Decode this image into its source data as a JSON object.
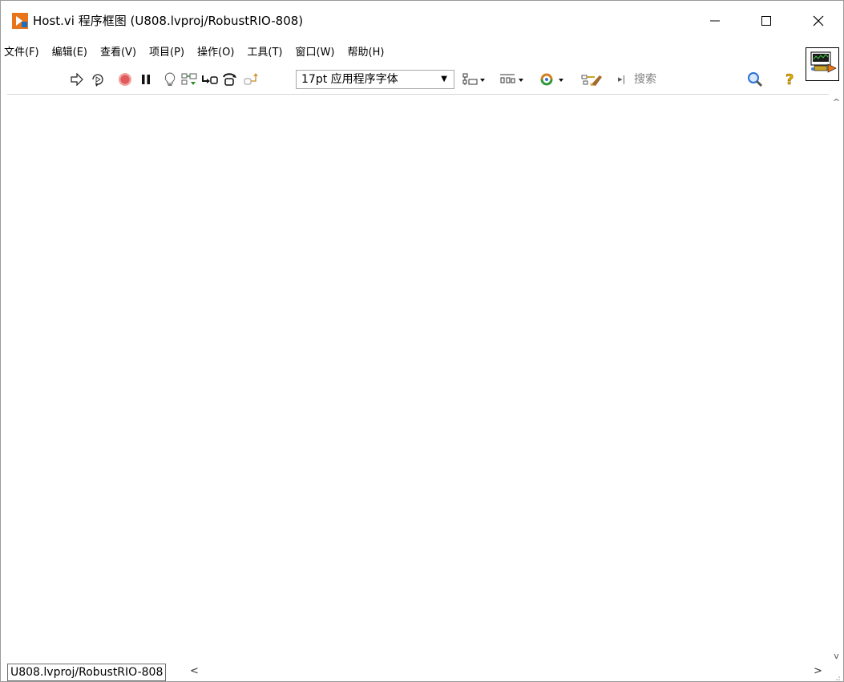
{
  "window": {
    "title": "Host.vi 程序框图  (U808.lvproj/RobustRIO-808)",
    "controls": {
      "minimize": "—",
      "maximize": "☐",
      "close": "✕"
    }
  },
  "menu": {
    "items": [
      "文件(F)",
      "编辑(E)",
      "查看(V)",
      "项目(P)",
      "操作(O)",
      "工具(T)",
      "窗口(W)",
      "帮助(H)"
    ]
  },
  "toolbar": {
    "font_select": "17pt 应用程序字体",
    "search_placeholder": "搜索",
    "search_marker": "▸|",
    "icons": [
      "run-arrow-icon",
      "run-continuously-icon",
      "abort-icon",
      "pause-icon",
      "highlight-execution-icon",
      "retain-wire-values-icon",
      "step-into-icon",
      "step-over-icon",
      "step-out-icon",
      "align-objects-icon",
      "distribute-objects-icon",
      "reorder-icon",
      "clean-up-diagram-icon",
      "search-icon",
      "help-icon"
    ]
  },
  "statusbar": {
    "context": "U808.lvproj/RobustRIO-808",
    "left_arrow": "<",
    "right_arrow": ">"
  },
  "scroll": {
    "up": "^",
    "down": "v"
  },
  "colors": {
    "app_icon": "#e8751a",
    "abort": "#e04040",
    "search": "#2a6fd6",
    "help": "#e0b000"
  }
}
